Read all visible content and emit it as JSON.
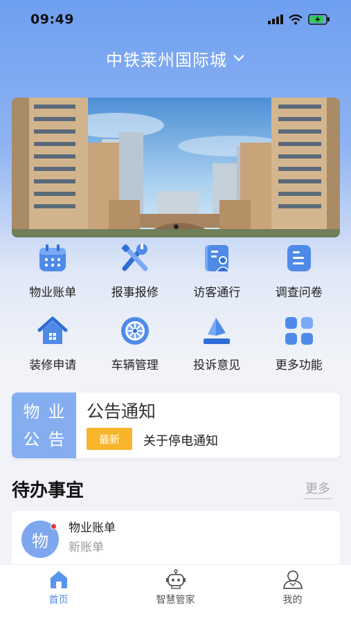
{
  "status_bar": {
    "time": "09:49"
  },
  "header": {
    "community_name": "中铁莱州国际城"
  },
  "banner": {
    "slide_count": 1,
    "active_slide": 0
  },
  "services": [
    {
      "label": "物业账单",
      "icon": "calendar-icon"
    },
    {
      "label": "报事报修",
      "icon": "wrench-screwdriver-icon"
    },
    {
      "label": "访客通行",
      "icon": "visitor-icon"
    },
    {
      "label": "调查问卷",
      "icon": "survey-icon"
    },
    {
      "label": "装修申请",
      "icon": "house-icon"
    },
    {
      "label": "车辆管理",
      "icon": "wheel-icon"
    },
    {
      "label": "投诉意见",
      "icon": "complaint-icon"
    },
    {
      "label": "更多功能",
      "icon": "grid-icon"
    }
  ],
  "notice": {
    "tag_line1": "物业",
    "tag_line2": "公告",
    "title": "公告通知",
    "badge": "最新",
    "text": "关于停电通知"
  },
  "todo": {
    "title": "待办事宜",
    "more": "更多",
    "items": [
      {
        "avatar": "物",
        "name": "物业账单",
        "subtitle": "新账单"
      }
    ]
  },
  "tabbar": {
    "tabs": [
      {
        "label": "首页",
        "icon": "home-icon",
        "active": true
      },
      {
        "label": "智慧管家",
        "icon": "robot-icon",
        "active": false
      },
      {
        "label": "我的",
        "icon": "user-icon",
        "active": false
      }
    ]
  },
  "colors": {
    "accent": "#4f8ae8",
    "badge": "#f7b52c",
    "notice_tag": "#84aef0"
  }
}
